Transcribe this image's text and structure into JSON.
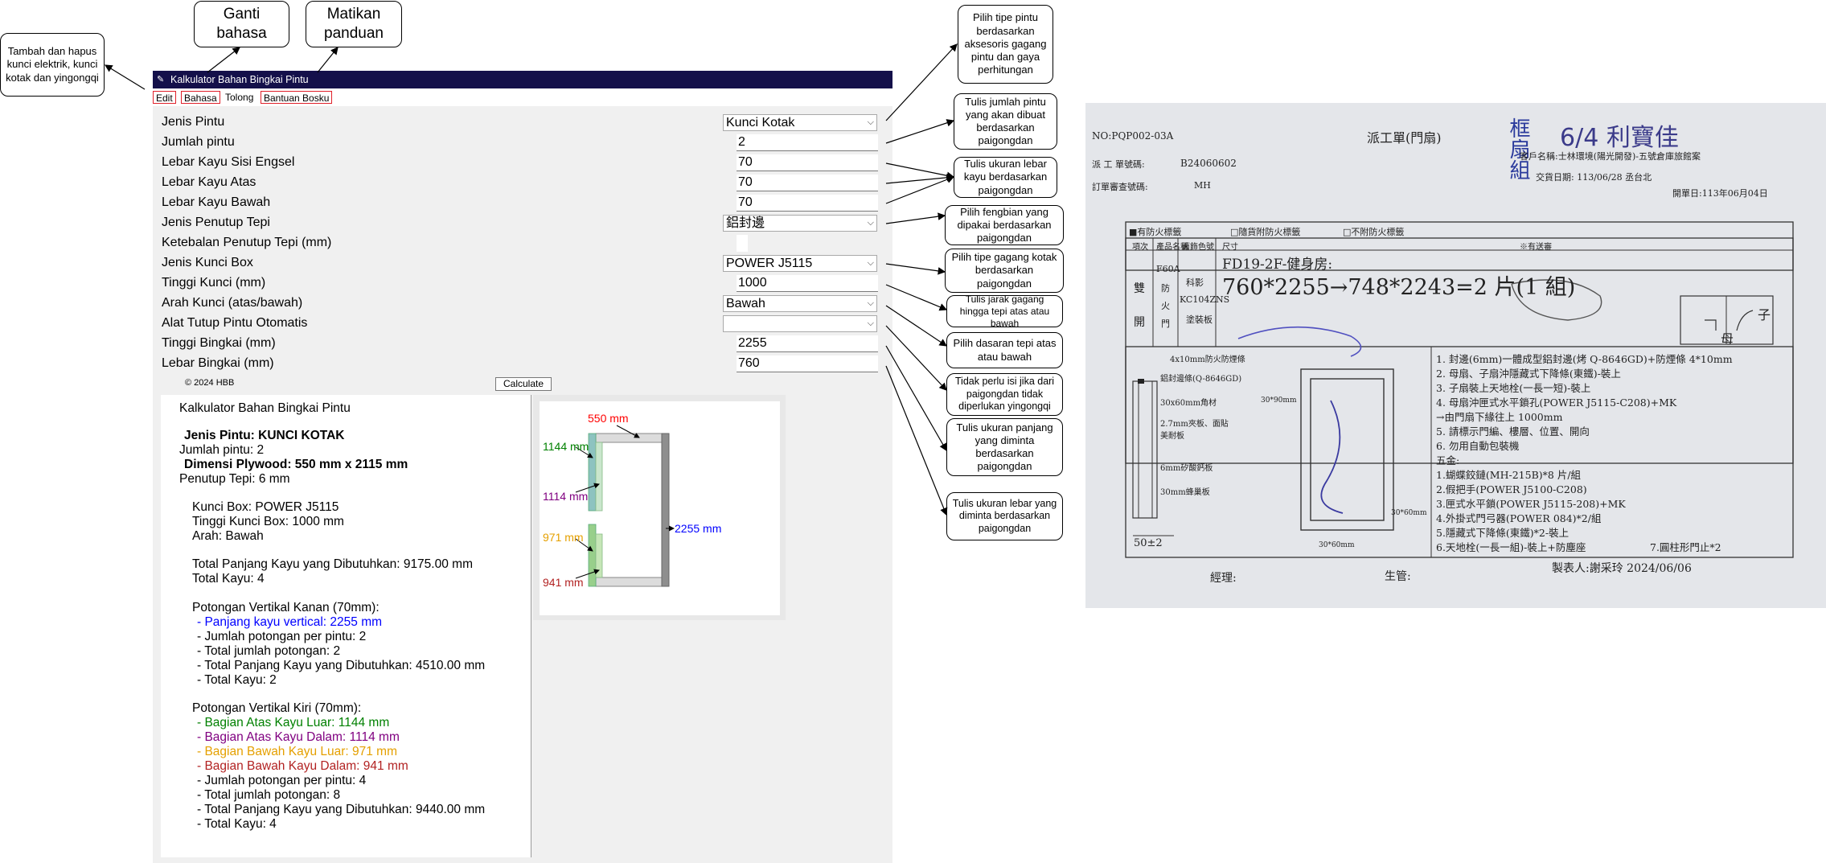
{
  "annotations": {
    "left": "Tambah dan hapus kunci elektrik, kunci kotak dan yingongqi",
    "top1": "Ganti bahasa",
    "top2": "Matikan panduan",
    "r1": "Pilih tipe pintu berdasarkan aksesoris gagang pintu dan gaya perhitungan",
    "r2": "Tulis jumlah pintu yang akan dibuat berdasarkan paigongdan",
    "r3": "Tulis ukuran lebar kayu berdasarkan paigongdan",
    "r4": "Pilih fengbian yang dipakai berdasarkan paigongdan",
    "r5": "Pilih tipe gagang kotak berdasarkan paigongdan",
    "r6": "Tulis jarak gagang hingga tepi atas atau bawah",
    "r7": "Pilih dasaran tepi atas atau bawah",
    "r8": "Tidak perlu isi jika dari paigongdan tidak diperlukan yingongqi",
    "r9": "Tulis ukuran panjang yang diminta berdasarkan paigongdan",
    "r10": "Tulis ukuran lebar yang diminta berdasarkan paigongdan"
  },
  "app": {
    "title": "Kalkulator Bahan Bingkai Pintu",
    "menu": [
      "Edit",
      "Bahasa",
      "Tolong",
      "Bantuan Bosku"
    ],
    "fields": {
      "jenis_pintu": {
        "label": "Jenis Pintu",
        "value": "Kunci Kotak"
      },
      "jumlah_pintu": {
        "label": "Jumlah pintu",
        "value": "2"
      },
      "lebar_sisi_engsel": {
        "label": "Lebar Kayu Sisi Engsel",
        "value": "70"
      },
      "lebar_atas": {
        "label": "Lebar Kayu Atas",
        "value": "70"
      },
      "lebar_bawah": {
        "label": "Lebar Kayu Bawah",
        "value": "70"
      },
      "jenis_penutup": {
        "label": "Jenis Penutup Tepi",
        "value": "鋁封邊"
      },
      "ketebalan_penutup": {
        "label": "Ketebalan Penutup Tepi (mm)",
        "value": ""
      },
      "jenis_kunci_box": {
        "label": "Jenis Kunci Box",
        "value": "POWER J5115"
      },
      "tinggi_kunci": {
        "label": "Tinggi Kunci (mm)",
        "value": "1000"
      },
      "arah_kunci": {
        "label": "Arah Kunci (atas/bawah)",
        "value": "Bawah"
      },
      "alat_tutup": {
        "label": "Alat Tutup Pintu Otomatis",
        "value": ""
      },
      "tinggi_bingkai": {
        "label": "Tinggi Bingkai (mm)",
        "value": "2255"
      },
      "lebar_bingkai": {
        "label": "Lebar Bingkai (mm)",
        "value": "760"
      }
    },
    "copyright": "© 2024 HBB",
    "calculate": "Calculate",
    "results": {
      "title": "Kalkulator Bahan Bingkai Pintu",
      "jenis": "Jenis Pintu: KUNCI KOTAK",
      "jumlah": "Jumlah pintu: 2",
      "dimensi": "Dimensi Plywood: 550 mm x 2115 mm",
      "penutup": "Penutup Tepi: 6 mm",
      "kunci_box": "Kunci Box: POWER J5115",
      "tinggi_kunci_box": "Tinggi Kunci Box: 1000 mm",
      "arah": "Arah: Bawah",
      "total_panjang_1": "Total Panjang Kayu yang Dibutuhkan: 9175.00 mm",
      "total_kayu_1": "Total Kayu: 4",
      "kanan_title": "Potongan Vertikal Kanan (70mm):",
      "kanan_panjang": "- Panjang kayu vertical: 2255 mm",
      "kanan_jumlah": "- Jumlah potongan per pintu: 2",
      "kanan_total_jumlah": "- Total jumlah potongan: 2",
      "kanan_total_panjang": "- Total Panjang Kayu yang Dibutuhkan: 4510.00 mm",
      "kanan_total_kayu": "- Total Kayu: 2",
      "kiri_title": "Potongan Vertikal Kiri (70mm):",
      "kiri_atas_luar": "- Bagian Atas Kayu Luar: 1144 mm",
      "kiri_atas_dalam": "- Bagian Atas Kayu Dalam: 1114 mm",
      "kiri_bawah_luar": "- Bagian Bawah Kayu Luar: 971 mm",
      "kiri_bawah_dalam": "- Bagian Bawah Kayu Dalam: 941 mm",
      "kiri_jumlah": "- Jumlah potongan per pintu: 4",
      "kiri_total_jumlah": "- Total jumlah potongan: 8",
      "kiri_total_panjang": "- Total Panjang Kayu yang Dibutuhkan: 9440.00 mm",
      "kiri_total_kayu": "- Total Kayu: 4"
    },
    "diagram": {
      "width_label": "550 mm",
      "height_label": "2255 mm",
      "l1": "1144 mm",
      "l2": "1114 mm",
      "l3": "971 mm",
      "l4": "941 mm"
    },
    "colors": {
      "blue": "#0000ff",
      "green": "#008000",
      "purple": "#800080",
      "orange": "#e5a000",
      "brown": "#b22222",
      "red": "#ff0000",
      "titlebar": "#14104a",
      "highlight": "#e0202a"
    }
  },
  "photo": {
    "header_no": "NO:PQP002-03A",
    "header_title": "派工單(門扇)",
    "stamp": "框扇組",
    "handwritten_top": "6/4 利寶佳",
    "work_no_label": "派 工 單號碼:",
    "work_no": "B24060602",
    "review_label": "訂單審查號碼:",
    "review_no": "MH",
    "customer": "客戶名稱:士林環境(陽光開發)-五號倉庫旅館案",
    "delivery": "交貨日期: 113/06/28 丞台北",
    "open_date": "開單日:113年06月04日",
    "cb1": "■有防火標籤",
    "cb2": "□隨貨附防火標籤",
    "cb3": "□不附防火標籤",
    "col_item": "項次",
    "col_name": "產品名稱",
    "col_color": "面飾色號",
    "col_size": "尺寸",
    "col_note": "※有送審",
    "v1": "雙",
    "v2": "開",
    "prod1": "F60A",
    "prod2": "防",
    "prod3": "火",
    "prod4": "門",
    "color1": "科影",
    "color2": "KC104ZNS",
    "color3": "塗裝板",
    "room": "FD19-2F-健身房:",
    "size_main": "760*2255→748*2243=2 片(1 組)",
    "note1": "1. 封邊(6mm)一體成型鋁封邊(烤 Q-8646GD)+防煙條 4*10mm",
    "note2": "2. 母扇、子扇沖隱藏式下降條(東鐵)-裝上",
    "note3": "3. 子扇裝上天地栓(一長一短)-裝上",
    "note4": "4. 母扇沖匣式水平鎖孔(POWER J5115-C208)+MK",
    "note5": "→由門扇下緣往上 1000mm",
    "note6": "5. 請標示門編、樓層、位置、開向",
    "note7": "6. 勿用自動包裝機",
    "hw_label": "五金:",
    "hw1": "1.蝴蝶鉸鏈(MH-215B)*8 片/組",
    "hw2": "2.假把手(POWER J5100-C208)",
    "hw3": "3.匣式水平鎖(POWER J5115-208)+MK",
    "hw4": "4.外掛式門弓器(POWER 084)*2/組",
    "hw5": "5.隱藏式下降條(東鐵)*2-裝上",
    "hw6": "6.天地栓(一長一組)-裝上+防塵座",
    "hw7": "7.圓柱形門止*2",
    "sec1": "4x10mm防火防煙條",
    "sec2": "鋁封邊條(Q-8646GD)",
    "sec3": "30x60mm角材",
    "sec4": "2.7mm夾板、面貼",
    "sec5": "美耐板",
    "sec6": "6mm矽酸鈣板",
    "sec7": "30mm蜂巢板",
    "sec8": "50±2",
    "dim1": "30*90mm",
    "dim2": "30*60mm",
    "dim3": "30*60mm",
    "sign1": "經理:",
    "sign2": "生管:",
    "maker": "製表人:謝采玲 2024/06/06",
    "mother": "母",
    "child": "子"
  }
}
